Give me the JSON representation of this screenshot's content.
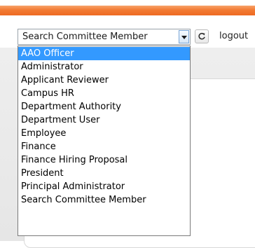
{
  "header": {
    "accent_color": "#ee6a22"
  },
  "toolbar": {
    "role_select_value": "Search Committee Member",
    "logout_label": "logout",
    "refresh_icon": "refresh-icon",
    "dropdown_icon": "chevron-down-icon"
  },
  "dropdown": {
    "selected_index": 0,
    "highlight_color": "#3399ff",
    "options": [
      "AAO Officer",
      "Administrator",
      "Applicant Reviewer",
      "Campus HR",
      "Department Authority",
      "Department User",
      "Employee",
      "Finance",
      "Finance Hiring Proposal",
      "President",
      "Principal Administrator",
      "Search Committee Member"
    ]
  }
}
